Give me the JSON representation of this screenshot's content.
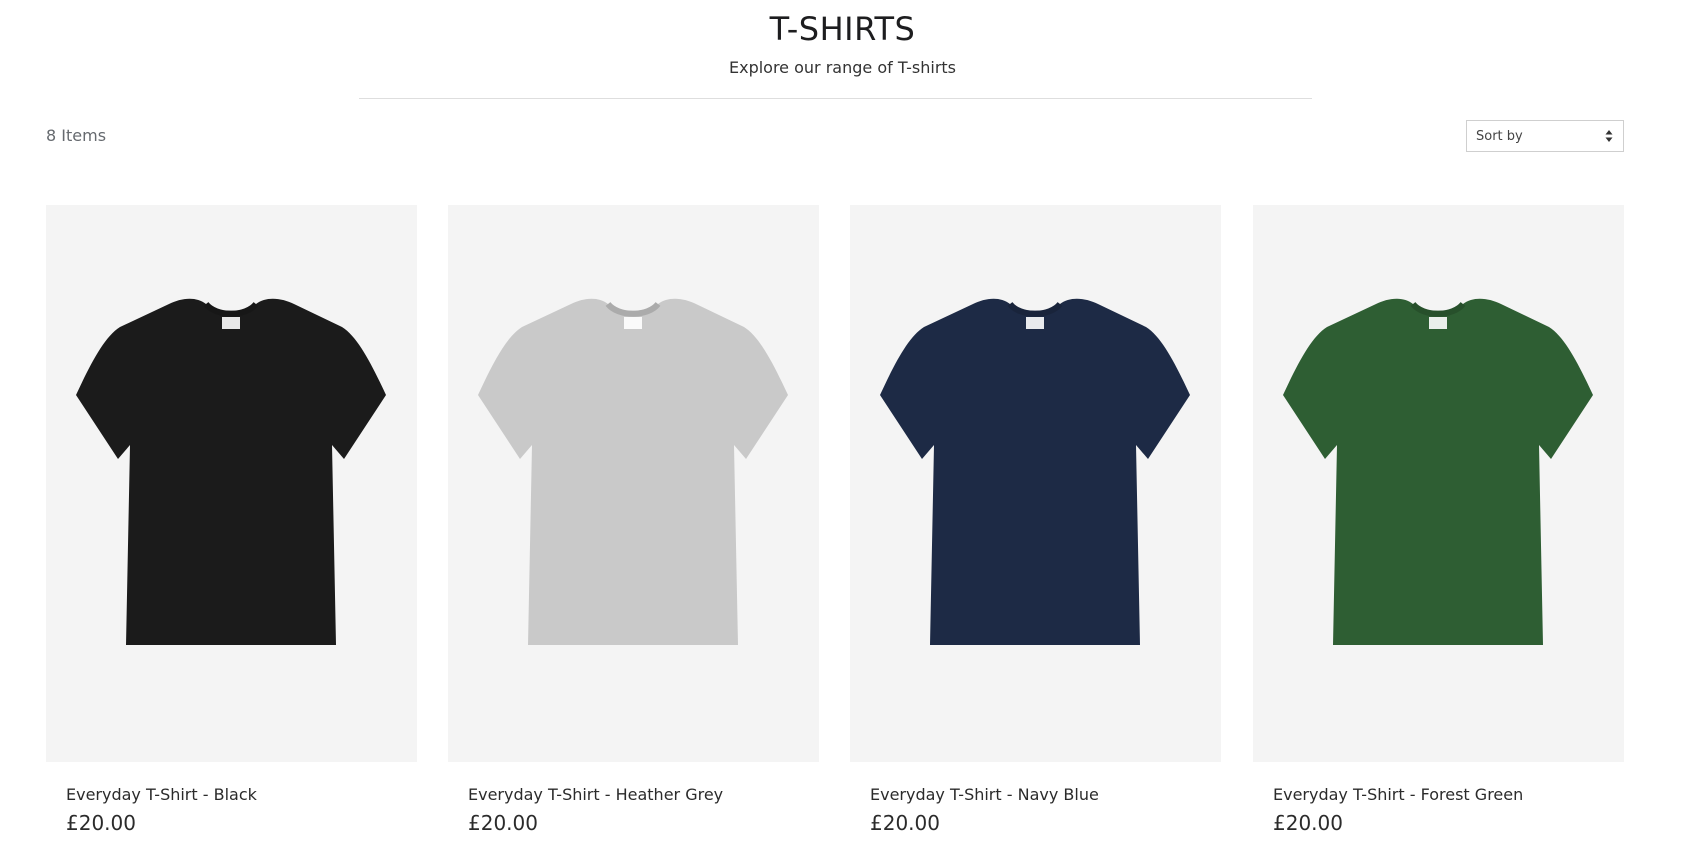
{
  "header": {
    "title": "T-SHIRTS",
    "subtitle": "Explore our range of T-shirts"
  },
  "toolbar": {
    "item_count": "8 Items",
    "sort_label": "Sort by"
  },
  "products": [
    {
      "name": "Everyday T-Shirt - Black",
      "price": "£20.00",
      "color": "#1b1b1b"
    },
    {
      "name": "Everyday T-Shirt - Heather Grey",
      "price": "£20.00",
      "color": "#c9c9c9"
    },
    {
      "name": "Everyday T-Shirt - Navy Blue",
      "price": "£20.00",
      "color": "#1d2a45"
    },
    {
      "name": "Everyday T-Shirt - Forest Green",
      "price": "£20.00",
      "color": "#2e5e33"
    }
  ],
  "colors": {
    "card_background": "#f4f4f4",
    "divider": "#dedede",
    "muted_text": "#666a6f"
  }
}
